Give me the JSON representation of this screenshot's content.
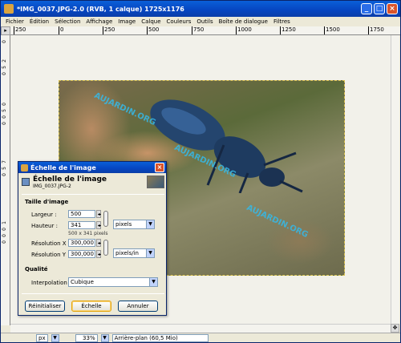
{
  "window": {
    "title": "*IMG_0037.JPG-2.0 (RVB, 1 calque) 1725x1176",
    "controls": [
      "_",
      "□",
      "×"
    ]
  },
  "menu": [
    "Fichier",
    "Édition",
    "Sélection",
    "Affichage",
    "Image",
    "Calque",
    "Couleurs",
    "Outils",
    "Boîte de dialogue",
    "Filtres"
  ],
  "ruler_top": [
    "250",
    "0",
    "250",
    "500",
    "750",
    "1000",
    "1250",
    "1500",
    "1750"
  ],
  "ruler_left": [
    "0",
    "2",
    "5",
    "0",
    "0",
    "5",
    "0",
    "0",
    "7",
    "5",
    "0",
    "1",
    "0",
    "0",
    "0"
  ],
  "watermarks": [
    "AUJARDIN.ORG",
    "AUJARDIN.ORG",
    "AUJARDIN.ORG"
  ],
  "statusbar": {
    "unit": "px",
    "zoom": "33%",
    "message": "Arrière-plan (60,5 Mio)"
  },
  "dialog": {
    "title": "Échelle de l'image",
    "heading": "Échelle de l'image",
    "subheading": "IMG_0037.JPG-2",
    "section_size": "Taille d'image",
    "width_label": "Largeur :",
    "width_value": "500",
    "height_label": "Hauteur :",
    "height_value": "341",
    "size_info": "500 x 341 pixels",
    "unit": "pixels",
    "res_x_label": "Résolution X :",
    "res_x_value": "300,000",
    "res_y_label": "Résolution Y :",
    "res_y_value": "300,000",
    "res_unit": "pixels/in",
    "section_quality": "Qualité",
    "interp_label": "Interpolation :",
    "interp_value": "Cubique",
    "buttons": {
      "reset": "Réinitialiser",
      "scale": "Échelle",
      "cancel": "Annuler"
    }
  }
}
